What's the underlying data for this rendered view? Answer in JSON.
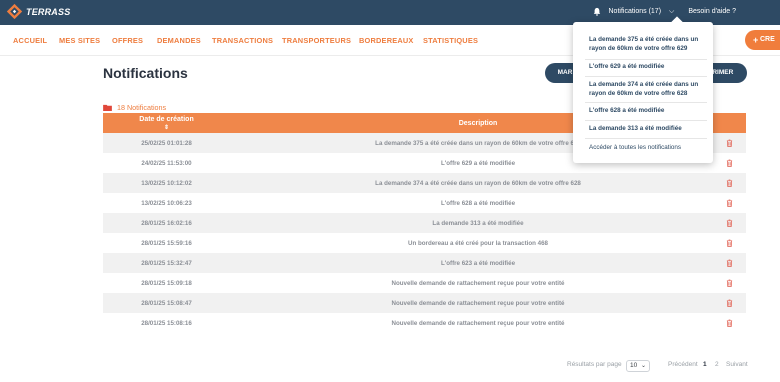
{
  "brand": {
    "name": "TERRASS",
    "accent": "#ee7d3f",
    "navy": "#2e4a64"
  },
  "topbar": {
    "notifications_label": "Notifications (17)",
    "help_label": "Besoin d'aide ?"
  },
  "nav": {
    "items": [
      {
        "label": "ACCUEIL"
      },
      {
        "label": "MES SITES"
      },
      {
        "label": "OFFRES"
      },
      {
        "label": "DEMANDES"
      },
      {
        "label": "TRANSACTIONS"
      },
      {
        "label": "TRANSPORTEURS"
      },
      {
        "label": "BORDEREAUX"
      },
      {
        "label": "STATISTIQUES"
      }
    ],
    "create_label": "CRE"
  },
  "page": {
    "title": "Notifications",
    "mark_button_label": "MAR",
    "delete_button_label": "PRIMER",
    "count_label": "18 Notifications"
  },
  "table": {
    "headers": {
      "date": "Date de création",
      "description": "Description",
      "sort_icon": "⇕"
    },
    "rows": [
      {
        "date": "25/02/25 01:01:28",
        "description": "La demande 375 a été créée dans un rayon de 60km de votre offre 629"
      },
      {
        "date": "24/02/25 11:53:00",
        "description": "L'offre 629 a été modifiée"
      },
      {
        "date": "13/02/25 10:12:02",
        "description": "La demande 374 a été créée dans un rayon de 60km de votre offre 628"
      },
      {
        "date": "13/02/25 10:06:23",
        "description": "L'offre 628 a été modifiée"
      },
      {
        "date": "28/01/25 16:02:16",
        "description": "La demande 313 a été modifiée"
      },
      {
        "date": "28/01/25 15:59:16",
        "description": "Un bordereau a été créé pour la transaction 468"
      },
      {
        "date": "28/01/25 15:32:47",
        "description": "L'offre 623 a été modifiée"
      },
      {
        "date": "28/01/25 15:09:18",
        "description": "Nouvelle demande de rattachement reçue pour votre entité"
      },
      {
        "date": "28/01/25 15:08:47",
        "description": "Nouvelle demande de rattachement reçue pour votre entité"
      },
      {
        "date": "28/01/25 15:08:16",
        "description": "Nouvelle demande de rattachement reçue pour votre entité"
      }
    ]
  },
  "pagination": {
    "per_page_label": "Résultats par page",
    "per_page_value": "10",
    "prev_label": "Précédent",
    "pages": [
      "1",
      "2"
    ],
    "current_page": "1",
    "next_label": "Suivant"
  },
  "dropdown": {
    "items": [
      {
        "label": "La demande 375 a été créée dans un rayon de 60km de votre offre 629"
      },
      {
        "label": "L'offre 629 a été modifiée"
      },
      {
        "label": "La demande 374 a été créée dans un rayon de 60km de votre offre 628"
      },
      {
        "label": "L'offre 628 a été modifiée"
      },
      {
        "label": "La demande 313 a été modifiée"
      }
    ],
    "all_label": "Accéder à toutes les notifications"
  }
}
